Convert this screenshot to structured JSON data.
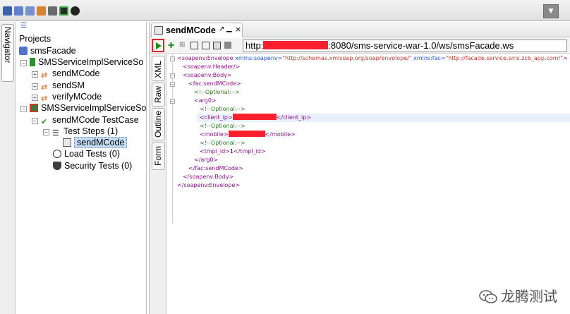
{
  "toolbar": {
    "icons": [
      "new-project-icon",
      "import-project-icon",
      "save-all-icon",
      "forum-icon",
      "preferences-icon",
      "proxy-icon",
      "about-icon"
    ],
    "dropdown_icon": "triangle-down-icon"
  },
  "navigator": {
    "tab_label": "Navigator",
    "root": "Projects",
    "project": "smsFacade",
    "interface": "SMSServiceImplServiceSo",
    "operations": [
      "sendMCode",
      "sendSM",
      "verifyMCode"
    ],
    "testsuite": "SMSServiceImplServiceSo",
    "testcase": "sendMCode TestCase",
    "test_steps": "Test Steps (1)",
    "step": "sendMCode",
    "load_tests": "Load Tests (0)",
    "security_tests": "Security Tests (0)"
  },
  "editor": {
    "tab_title": "sendMCode",
    "tab_controls": [
      "pin-icon",
      "minimize-icon",
      "close-icon"
    ],
    "url_prefix": "http:",
    "url_suffix": ":8080/sms-service-war-1.0/ws/smsFacade.ws",
    "side_tabs": [
      "XML",
      "Raw",
      "Outline",
      "Form"
    ],
    "xml": {
      "envelope_open": "<soapenv:Envelope",
      "ns1_attr": "xmlns:soapenv=",
      "ns1_val": "\"http://schemas.xmlsoap.org/soap/envelope/\"",
      "ns2_attr": "xmlns:fac=",
      "ns2_val": "\"http://facade.service.sms.zcb_app.com/\"",
      "envelope_end": ">",
      "header": "<soapenv:Header/>",
      "body_open": "<soapenv:Body>",
      "op_open": "<fac:sendMCode>",
      "comment": "<!--Optional:-->",
      "arg_open": "<arg0>",
      "client_ip_open": "<client_ip>",
      "client_ip_close": "</client_ip>",
      "mobile_open": "<mobile>",
      "mobile_close": "</mobile>",
      "tmpl_open": "<tmpl_id>",
      "tmpl_value": "1",
      "tmpl_close": "</tmpl_id>",
      "arg_close": "</arg0>",
      "op_close": "</fac:sendMCode>",
      "body_close": "</soapenv:Body>",
      "envelope_close": "</soapenv:Envelope>"
    }
  },
  "watermark": {
    "text": "龙腾测试",
    "logo_icon": "wechat-logo-icon"
  },
  "colors": {
    "redaction": "#ff1f2f",
    "run_highlight": "#e3262c",
    "run_icon": "#1a8d1a",
    "xml_tag": "#8b0d8b",
    "xml_attr": "#1a56c4",
    "xml_value": "#b23a2a",
    "xml_comment": "#2f7f2f"
  }
}
